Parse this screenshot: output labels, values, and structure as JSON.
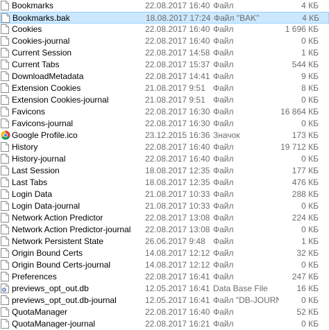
{
  "file_list": {
    "rows": [
      {
        "name": "Bookmarks",
        "date": "22.08.2017 16:40",
        "type": "Файл",
        "size": "4 КБ",
        "icon": "file-icon",
        "selected": false
      },
      {
        "name": "Bookmarks.bak",
        "date": "18.08.2017 17:24",
        "type": "Файл \"BAK\"",
        "size": "4 КБ",
        "icon": "file-icon",
        "selected": true
      },
      {
        "name": "Cookies",
        "date": "22.08.2017 16:40",
        "type": "Файл",
        "size": "1 696 КБ",
        "icon": "file-icon",
        "selected": false
      },
      {
        "name": "Cookies-journal",
        "date": "22.08.2017 16:40",
        "type": "Файл",
        "size": "0 КБ",
        "icon": "file-icon",
        "selected": false
      },
      {
        "name": "Current Session",
        "date": "22.08.2017 14:58",
        "type": "Файл",
        "size": "1 КБ",
        "icon": "file-icon",
        "selected": false
      },
      {
        "name": "Current Tabs",
        "date": "22.08.2017 15:37",
        "type": "Файл",
        "size": "544 КБ",
        "icon": "file-icon",
        "selected": false
      },
      {
        "name": "DownloadMetadata",
        "date": "22.08.2017 14:41",
        "type": "Файл",
        "size": "9 КБ",
        "icon": "file-icon",
        "selected": false
      },
      {
        "name": "Extension Cookies",
        "date": "21.08.2017 9:51",
        "type": "Файл",
        "size": "8 КБ",
        "icon": "file-icon",
        "selected": false
      },
      {
        "name": "Extension Cookies-journal",
        "date": "21.08.2017 9:51",
        "type": "Файл",
        "size": "0 КБ",
        "icon": "file-icon",
        "selected": false
      },
      {
        "name": "Favicons",
        "date": "22.08.2017 16:30",
        "type": "Файл",
        "size": "16 864 КБ",
        "icon": "file-icon",
        "selected": false
      },
      {
        "name": "Favicons-journal",
        "date": "22.08.2017 16:30",
        "type": "Файл",
        "size": "0 КБ",
        "icon": "file-icon",
        "selected": false
      },
      {
        "name": "Google Profile.ico",
        "date": "23.12.2015 16:36",
        "type": "Значок",
        "size": "173 КБ",
        "icon": "chrome-icon",
        "selected": false
      },
      {
        "name": "History",
        "date": "22.08.2017 16:40",
        "type": "Файл",
        "size": "19 712 КБ",
        "icon": "file-icon",
        "selected": false
      },
      {
        "name": "History-journal",
        "date": "22.08.2017 16:40",
        "type": "Файл",
        "size": "0 КБ",
        "icon": "file-icon",
        "selected": false
      },
      {
        "name": "Last Session",
        "date": "18.08.2017 12:35",
        "type": "Файл",
        "size": "177 КБ",
        "icon": "file-icon",
        "selected": false
      },
      {
        "name": "Last Tabs",
        "date": "18.08.2017 12:35",
        "type": "Файл",
        "size": "476 КБ",
        "icon": "file-icon",
        "selected": false
      },
      {
        "name": "Login Data",
        "date": "21.08.2017 10:33",
        "type": "Файл",
        "size": "288 КБ",
        "icon": "file-icon",
        "selected": false
      },
      {
        "name": "Login Data-journal",
        "date": "21.08.2017 10:33",
        "type": "Файл",
        "size": "0 КБ",
        "icon": "file-icon",
        "selected": false
      },
      {
        "name": "Network Action Predictor",
        "date": "22.08.2017 13:08",
        "type": "Файл",
        "size": "224 КБ",
        "icon": "file-icon",
        "selected": false
      },
      {
        "name": "Network Action Predictor-journal",
        "date": "22.08.2017 13:08",
        "type": "Файл",
        "size": "0 КБ",
        "icon": "file-icon",
        "selected": false
      },
      {
        "name": "Network Persistent State",
        "date": "26.06.2017 9:48",
        "type": "Файл",
        "size": "1 КБ",
        "icon": "file-icon",
        "selected": false
      },
      {
        "name": "Origin Bound Certs",
        "date": "14.08.2017 12:12",
        "type": "Файл",
        "size": "32 КБ",
        "icon": "file-icon",
        "selected": false
      },
      {
        "name": "Origin Bound Certs-journal",
        "date": "14.08.2017 12:12",
        "type": "Файл",
        "size": "0 КБ",
        "icon": "file-icon",
        "selected": false
      },
      {
        "name": "Preferences",
        "date": "22.08.2017 16:41",
        "type": "Файл",
        "size": "247 КБ",
        "icon": "file-icon",
        "selected": false
      },
      {
        "name": "previews_opt_out.db",
        "date": "12.05.2017 16:41",
        "type": "Data Base File",
        "size": "16 КБ",
        "icon": "db-file-icon",
        "selected": false
      },
      {
        "name": "previews_opt_out.db-journal",
        "date": "12.05.2017 16:41",
        "type": "Файл \"DB-JOURN...\"",
        "size": "0 КБ",
        "icon": "file-icon",
        "selected": false
      },
      {
        "name": "QuotaManager",
        "date": "22.08.2017 16:40",
        "type": "Файл",
        "size": "52 КБ",
        "icon": "file-icon",
        "selected": false
      },
      {
        "name": "QuotaManager-journal",
        "date": "22.08.2017 16:21",
        "type": "Файл",
        "size": "0 КБ",
        "icon": "file-icon",
        "selected": false
      }
    ]
  },
  "colors": {
    "selection_fill": "#cce8ff",
    "selection_border": "#99d1ff",
    "secondary_text": "#6d6d6d"
  }
}
